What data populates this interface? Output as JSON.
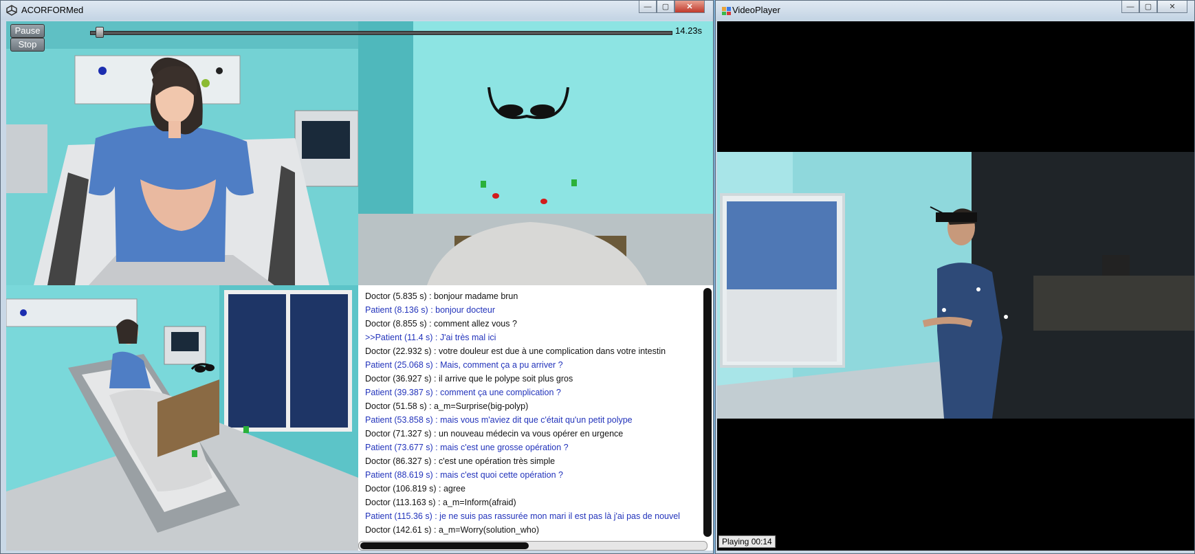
{
  "left_window": {
    "title": "ACORFORMed",
    "controls": {
      "minimize": "—",
      "maximize": "▢",
      "close": "✕"
    },
    "player": {
      "pause_label": "Pause",
      "stop_label": "Stop",
      "time": "14.23s",
      "progress": 0.01
    },
    "log": [
      {
        "who": "doctor",
        "text": "Doctor (5.835 s) : bonjour madame brun"
      },
      {
        "who": "patient",
        "text": "Patient (8.136 s) : bonjour  docteur"
      },
      {
        "who": "doctor",
        "text": "Doctor (8.855 s) : comment allez vous ?"
      },
      {
        "who": "patient",
        "text": ">>Patient (11.4 s) : J'ai très mal ici"
      },
      {
        "who": "doctor",
        "text": "Doctor (22.932 s) : votre douleur est due à une complication dans votre intestin"
      },
      {
        "who": "patient",
        "text": "Patient (25.068 s) : Mais, comment ça a pu arriver ?"
      },
      {
        "who": "doctor",
        "text": "Doctor (36.927 s) : il arrive que le polype soit plus gros"
      },
      {
        "who": "patient",
        "text": "Patient (39.387 s) : comment ça une complication ?"
      },
      {
        "who": "doctor",
        "text": "Doctor (51.58 s) : a_m=Surprise(big-polyp)"
      },
      {
        "who": "patient",
        "text": "Patient (53.858 s) : mais vous m'aviez dit que c'était qu'un petit polype"
      },
      {
        "who": "doctor",
        "text": "Doctor (71.327 s) : un nouveau médecin va vous opérer en urgence"
      },
      {
        "who": "patient",
        "text": "Patient (73.677 s) : mais c'est une grosse opération ?"
      },
      {
        "who": "doctor",
        "text": "Doctor (86.327 s) : c'est une opération très simple"
      },
      {
        "who": "patient",
        "text": "Patient (88.619 s) : mais c'est quoi cette opération ?"
      },
      {
        "who": "doctor",
        "text": "Doctor (106.819 s) : agree"
      },
      {
        "who": "doctor",
        "text": "Doctor (113.163 s) : a_m=Inform(afraid)"
      },
      {
        "who": "patient",
        "text": "Patient (115.36 s) : je ne suis pas rassurée mon mari il est pas là j'ai pas de nouvel"
      },
      {
        "who": "doctor",
        "text": "Doctor (142.61 s) : a_m=Worry(solution_who)"
      }
    ]
  },
  "right_window": {
    "title": "VideoPlayer",
    "controls": {
      "minimize": "—",
      "maximize": "▢",
      "close": "✕"
    },
    "status": "Playing 00:14"
  },
  "colors": {
    "doctor_text": "#111111",
    "patient_text": "#2233bb",
    "room_wall": "#7fd7d8"
  }
}
